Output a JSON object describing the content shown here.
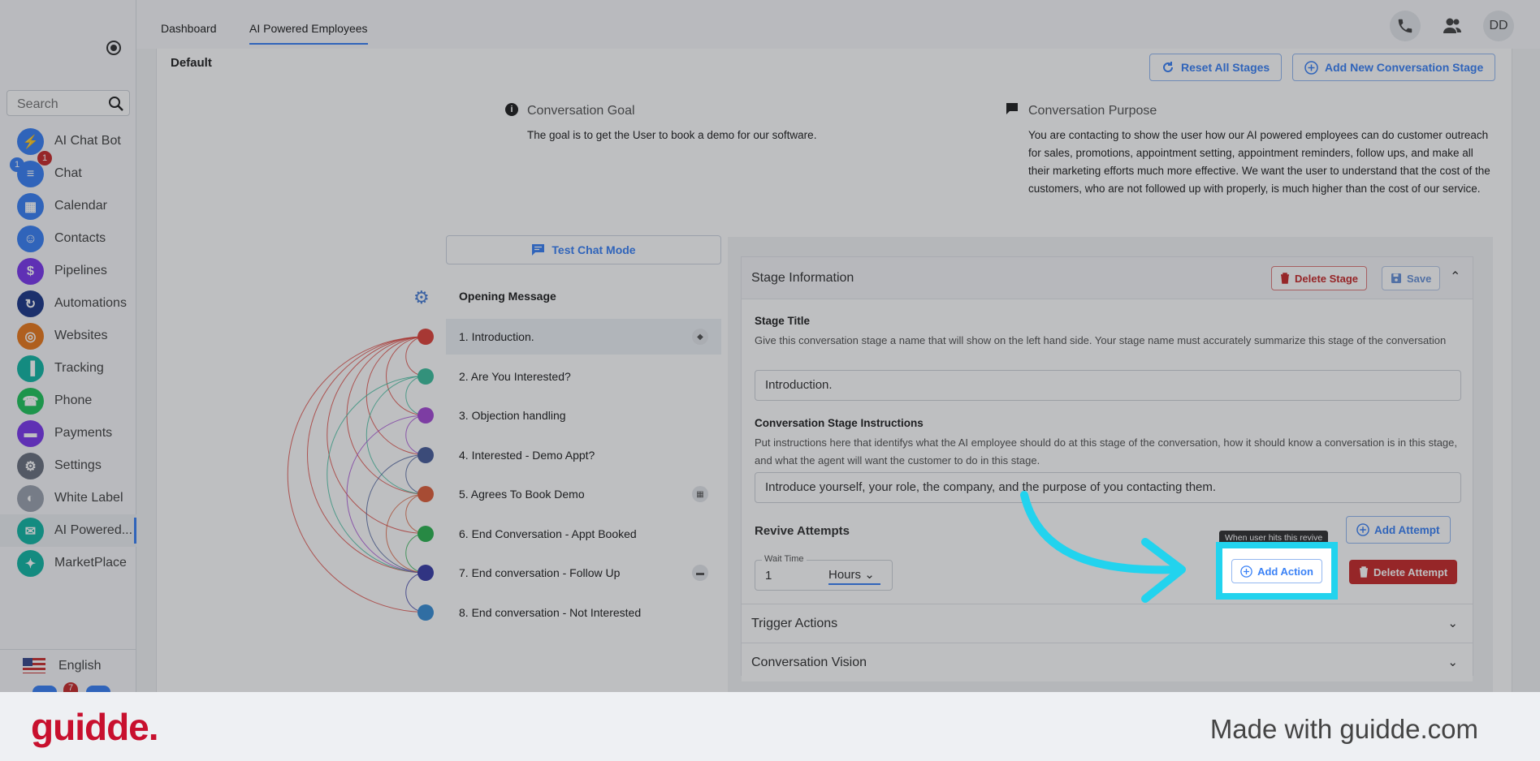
{
  "topbar": {
    "tabs": [
      "Dashboard",
      "AI Powered Employees"
    ],
    "avatar": "DD"
  },
  "sidebar": {
    "search_placeholder": "Search",
    "items": [
      {
        "label": "AI Chat Bot",
        "color": "#3b82f6",
        "icon": "bolt-icon"
      },
      {
        "label": "Chat",
        "color": "#3b82f6",
        "icon": "chat-icon",
        "badges": [
          "1",
          "1"
        ]
      },
      {
        "label": "Calendar",
        "color": "#3b82f6",
        "icon": "calendar-icon"
      },
      {
        "label": "Contacts",
        "color": "#3b82f6",
        "icon": "contacts-icon"
      },
      {
        "label": "Pipelines",
        "color": "#7c3aed",
        "icon": "dollar-icon"
      },
      {
        "label": "Automations",
        "color": "#1e3a8a",
        "icon": "automation-icon"
      },
      {
        "label": "Websites",
        "color": "#ea7a1e",
        "icon": "globe-icon"
      },
      {
        "label": "Tracking",
        "color": "#14b8a6",
        "icon": "chart-icon"
      },
      {
        "label": "Phone",
        "color": "#22c55e",
        "icon": "phone-icon"
      },
      {
        "label": "Payments",
        "color": "#7c3aed",
        "icon": "card-icon"
      },
      {
        "label": "Settings",
        "color": "#6b7280",
        "icon": "gear-icon"
      },
      {
        "label": "White Label",
        "color": "#9ca3af",
        "icon": "palette-icon"
      },
      {
        "label": "AI Powered...",
        "color": "#14b8a6",
        "icon": "ai-icon"
      },
      {
        "label": "MarketPlace",
        "color": "#14b8a6",
        "icon": "marketplace-icon"
      }
    ],
    "language": "English",
    "bottom_badge": "7"
  },
  "main": {
    "section_label": "Default",
    "reset_button": "Reset All Stages",
    "add_stage_button": "Add New Conversation Stage",
    "goal_title": "Conversation Goal",
    "goal_text": "The goal is to get the User to book a demo for our software.",
    "purpose_title": "Conversation Purpose",
    "purpose_text": "You are contacting to show the user how our AI powered employees can do customer outreach for sales, promotions, appointment setting, appointment reminders, follow ups, and make all their marketing efforts much more effective. We want the user to understand that the cost of the customers, who are not followed up with properly, is much higher than the cost of our service.",
    "test_chat_button": "Test Chat Mode",
    "opening_message": "Opening Message",
    "stages": [
      {
        "label": "1. Introduction.",
        "dot": "#e0443c",
        "icon": "tag-icon"
      },
      {
        "label": "2. Are You Interested?",
        "dot": "#3fbf9f",
        "icon": ""
      },
      {
        "label": "3. Objection handling",
        "dot": "#a64bd6",
        "icon": ""
      },
      {
        "label": "4. Interested - Demo Appt?",
        "dot": "#4a5f9c",
        "icon": ""
      },
      {
        "label": "5. Agrees To Book Demo",
        "dot": "#e0603c",
        "icon": "calendar-icon"
      },
      {
        "label": "6. End Conversation - Appt Booked",
        "dot": "#2fb553",
        "icon": ""
      },
      {
        "label": "7. End conversation - Follow Up",
        "dot": "#3b3fa8",
        "icon": "message-icon"
      },
      {
        "label": "8. End conversation - Not Interested",
        "dot": "#3b8fd6",
        "icon": ""
      }
    ]
  },
  "stage_panel": {
    "title": "Stage Information",
    "delete_stage": "Delete Stage",
    "save": "Save",
    "stage_title_label": "Stage Title",
    "stage_title_help": "Give this conversation stage a name that will show on the left hand side. Your stage name must accurately summarize this stage of the conversation",
    "stage_title_value": "Introduction.",
    "instructions_label": "Conversation Stage Instructions",
    "instructions_help": "Put instructions here that identifys what the AI employee should do at this stage of the conversation, how it should know a conversation is in this stage, and what the agent will want the customer to do in this stage.",
    "instructions_value": "Introduce yourself, your role, the company, and the purpose of you contacting them.",
    "revive_label": "Revive Attempts",
    "add_attempt": "Add Attempt",
    "wait_time_label": "Wait Time",
    "wait_time_value": "1",
    "wait_unit": "Hours",
    "tooltip": "When user hits this revive",
    "add_action": "Add Action",
    "delete_attempt": "Delete Attempt",
    "trigger_actions": "Trigger Actions",
    "conversation_vision": "Conversation Vision"
  },
  "footer": {
    "logo": "guidde.",
    "made_with": "Made with guidde.com"
  },
  "colors": {
    "accent": "#3b82f6",
    "danger": "#c82b2b",
    "highlight": "#22d3ee",
    "brand": "#c8102e"
  }
}
